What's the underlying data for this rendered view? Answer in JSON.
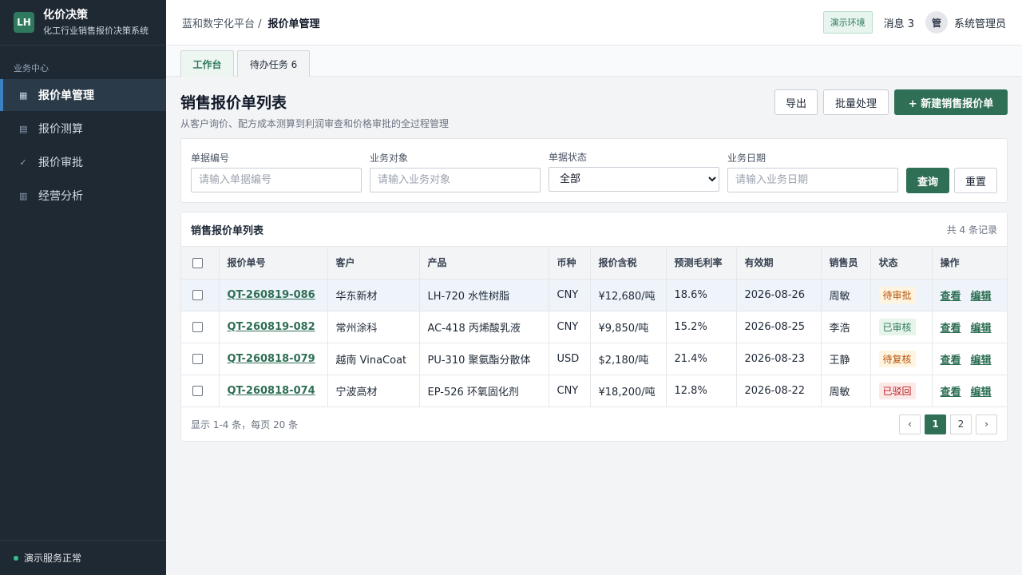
{
  "brand": {
    "logo": "LH",
    "title": "化价决策",
    "subtitle": "化工行业销售报价决策系统"
  },
  "sidebar": {
    "section": "业务中心",
    "items": [
      {
        "label": "报价单管理",
        "icon": "▦",
        "active": true
      },
      {
        "label": "报价测算",
        "icon": "▤",
        "active": false
      },
      {
        "label": "报价审批",
        "icon": "✓",
        "active": false
      },
      {
        "label": "经营分析",
        "icon": "▥",
        "active": false
      }
    ],
    "status": "演示服务正常"
  },
  "header": {
    "breadcrumb_root": "蓝和数字化平台 /",
    "breadcrumb_current": "报价单管理",
    "env_badge": "演示环境",
    "messages": "消息 3",
    "avatar": "管",
    "user": "系统管理员"
  },
  "tabs": [
    {
      "label": "工作台"
    },
    {
      "label": "待办任务 6"
    }
  ],
  "page": {
    "title": "销售报价单列表",
    "subtitle": "从客户询价、配方成本测算到利润审查和价格审批的全过程管理",
    "export": "导出",
    "batch": "批量处理",
    "create": "+ 新建销售报价单"
  },
  "filters": {
    "no_label": "单据编号",
    "no_placeholder": "请输入单据编号",
    "obj_label": "业务对象",
    "obj_placeholder": "请输入业务对象",
    "status_label": "单据状态",
    "status_value": "全部",
    "date_label": "业务日期",
    "date_placeholder": "请输入业务日期",
    "query": "查询",
    "reset": "重置"
  },
  "list": {
    "title": "销售报价单列表",
    "count": "共 4 条记录",
    "columns": [
      "报价单号",
      "客户",
      "产品",
      "币种",
      "报价含税",
      "预测毛利率",
      "有效期",
      "销售员",
      "状态",
      "操作"
    ],
    "rows": [
      {
        "no": "QT-260819-086",
        "customer": "华东新材",
        "product": "LH-720 水性树脂",
        "currency": "CNY",
        "price": "¥12,680/吨",
        "margin": "18.6%",
        "valid": "2026-08-26",
        "sales": "周敏",
        "status": "待审批"
      },
      {
        "no": "QT-260819-082",
        "customer": "常州涂科",
        "product": "AC-418 丙烯酸乳液",
        "currency": "CNY",
        "price": "¥9,850/吨",
        "margin": "15.2%",
        "valid": "2026-08-25",
        "sales": "李浩",
        "status": "已审核"
      },
      {
        "no": "QT-260818-079",
        "customer": "越南 VinaCoat",
        "product": "PU-310 聚氨酯分散体",
        "currency": "USD",
        "price": "$2,180/吨",
        "margin": "21.4%",
        "valid": "2026-08-23",
        "sales": "王静",
        "status": "待复核"
      },
      {
        "no": "QT-260818-074",
        "customer": "宁波高材",
        "product": "EP-526 环氧固化剂",
        "currency": "CNY",
        "price": "¥18,200/吨",
        "margin": "12.8%",
        "valid": "2026-08-22",
        "sales": "周敏",
        "status": "已驳回"
      }
    ],
    "view": "查看",
    "edit": "编辑",
    "footer": "显示 1-4 条，每页 20 条",
    "pager": {
      "prev": "‹",
      "pages": [
        "1",
        "2"
      ],
      "next": "›"
    }
  }
}
